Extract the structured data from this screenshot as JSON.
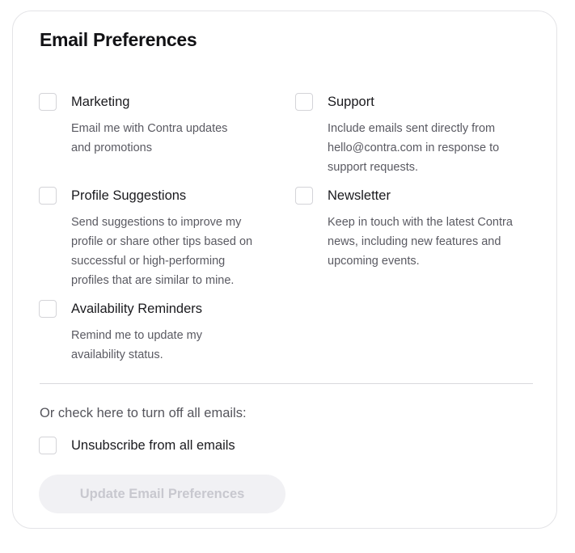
{
  "title": "Email Preferences",
  "options": {
    "marketing": {
      "label": "Marketing",
      "desc_lines": [
        "Email me with Contra updates",
        "and promotions"
      ],
      "checked": false
    },
    "support": {
      "label": "Support",
      "desc_lines": [
        "Include emails sent directly from",
        "hello@contra.com in response to",
        "support requests."
      ],
      "checked": false
    },
    "profile_suggestions": {
      "label": "Profile Suggestions",
      "desc_lines": [
        "Send suggestions to improve my",
        "profile or share other tips based on",
        "successful or high-performing",
        "profiles that are similar to mine."
      ],
      "checked": false
    },
    "newsletter": {
      "label": "Newsletter",
      "desc_lines": [
        "Keep in touch with the latest Contra",
        "news, including new features and",
        "upcoming events."
      ],
      "checked": false
    },
    "availability_reminders": {
      "label": "Availability Reminders",
      "desc_lines": [
        "Remind me to update my",
        "availability status."
      ],
      "checked": false
    }
  },
  "unsubscribe": {
    "prompt": "Or check here to turn off all emails:",
    "label": "Unsubscribe from all emails",
    "checked": false
  },
  "update_button": {
    "label": "Update Email Preferences",
    "disabled": true
  },
  "colors": {
    "button_bg_disabled": "#f1f1f4",
    "button_text_disabled": "#c8c8cf",
    "border": "#e4e4e7"
  }
}
